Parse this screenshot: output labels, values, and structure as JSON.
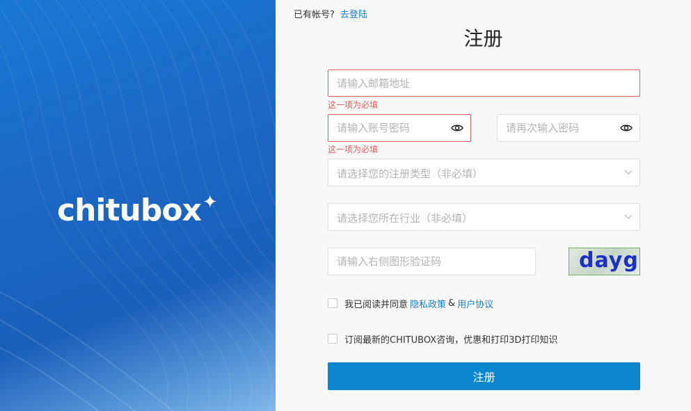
{
  "brand": {
    "logo_text": "chitubox",
    "logo_star": "✦",
    "colors": {
      "panel": "#1b66c2",
      "accent": "#0a86cf",
      "error": "#e35d5d",
      "link": "#1a7fc1"
    }
  },
  "header": {
    "has_account_text": "已有帐号?",
    "login_link": "去登陆",
    "title": "注册"
  },
  "form": {
    "email_placeholder": "请输入邮箱地址",
    "email_error": "这一项为必填",
    "password_placeholder": "请输入账号密码",
    "password_error": "这一项为必填",
    "confirm_placeholder": "请再次输入密码",
    "reg_type_placeholder": "请选择您的注册类型（非必填）",
    "industry_placeholder": "请选择您所在行业（非必填）",
    "captcha_placeholder": "请输入右侧图形验证码",
    "captcha_text": "dayg",
    "agree_text": "我已阅读并同意",
    "privacy_link": "隐私政策",
    "amp": "&",
    "terms_link": "用户协议",
    "subscribe_text": "订阅最新的CHITUBOX咨询，优惠和打印3D打印知识",
    "submit_label": "注册"
  },
  "icons": {
    "eye": "eye-icon",
    "chevron": "chevron-down-icon",
    "checkbox": "checkbox"
  }
}
